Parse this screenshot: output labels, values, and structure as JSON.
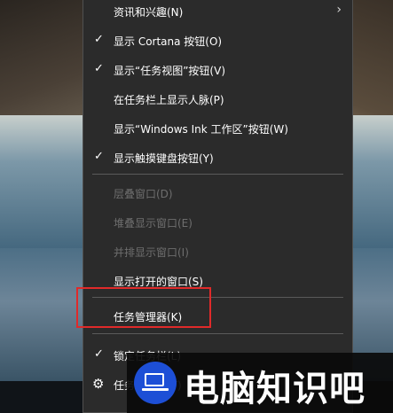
{
  "colors": {
    "menu_bg": "#2b2b2b",
    "menu_text": "#ffffff",
    "disabled_text": "#6e6e6e",
    "highlight_border": "#e02a2a",
    "logo_blue": "#1d4fd6"
  },
  "context_menu": {
    "items": [
      {
        "label": "资讯和兴趣(N)",
        "has_submenu": true,
        "checked": false
      },
      {
        "label": "显示 Cortana 按钮(O)",
        "checked": true
      },
      {
        "label": "显示“任务视图”按钮(V)",
        "checked": true
      },
      {
        "label": "在任务栏上显示人脉(P)",
        "checked": false
      },
      {
        "label": "显示“Windows Ink 工作区”按钮(W)",
        "checked": false
      },
      {
        "label": "显示触摸键盘按钮(Y)",
        "checked": true
      },
      {
        "label": "层叠窗口(D)",
        "disabled": true
      },
      {
        "label": "堆叠显示窗口(E)",
        "disabled": true
      },
      {
        "label": "并排显示窗口(I)",
        "disabled": true
      },
      {
        "label": "显示打开的窗口(S)",
        "checked": false
      },
      {
        "label": "任务管理器(K)",
        "highlighted": true
      },
      {
        "label": "锁定任务栏(L)",
        "checked": true
      },
      {
        "label": "任务栏设置(T)",
        "icon": "gear-icon"
      }
    ],
    "check_glyph": "✓",
    "submenu_glyph": "›",
    "gear_glyph": "⚙"
  },
  "watermark": {
    "text": "电脑知识吧",
    "icon": "laptop-icon"
  }
}
